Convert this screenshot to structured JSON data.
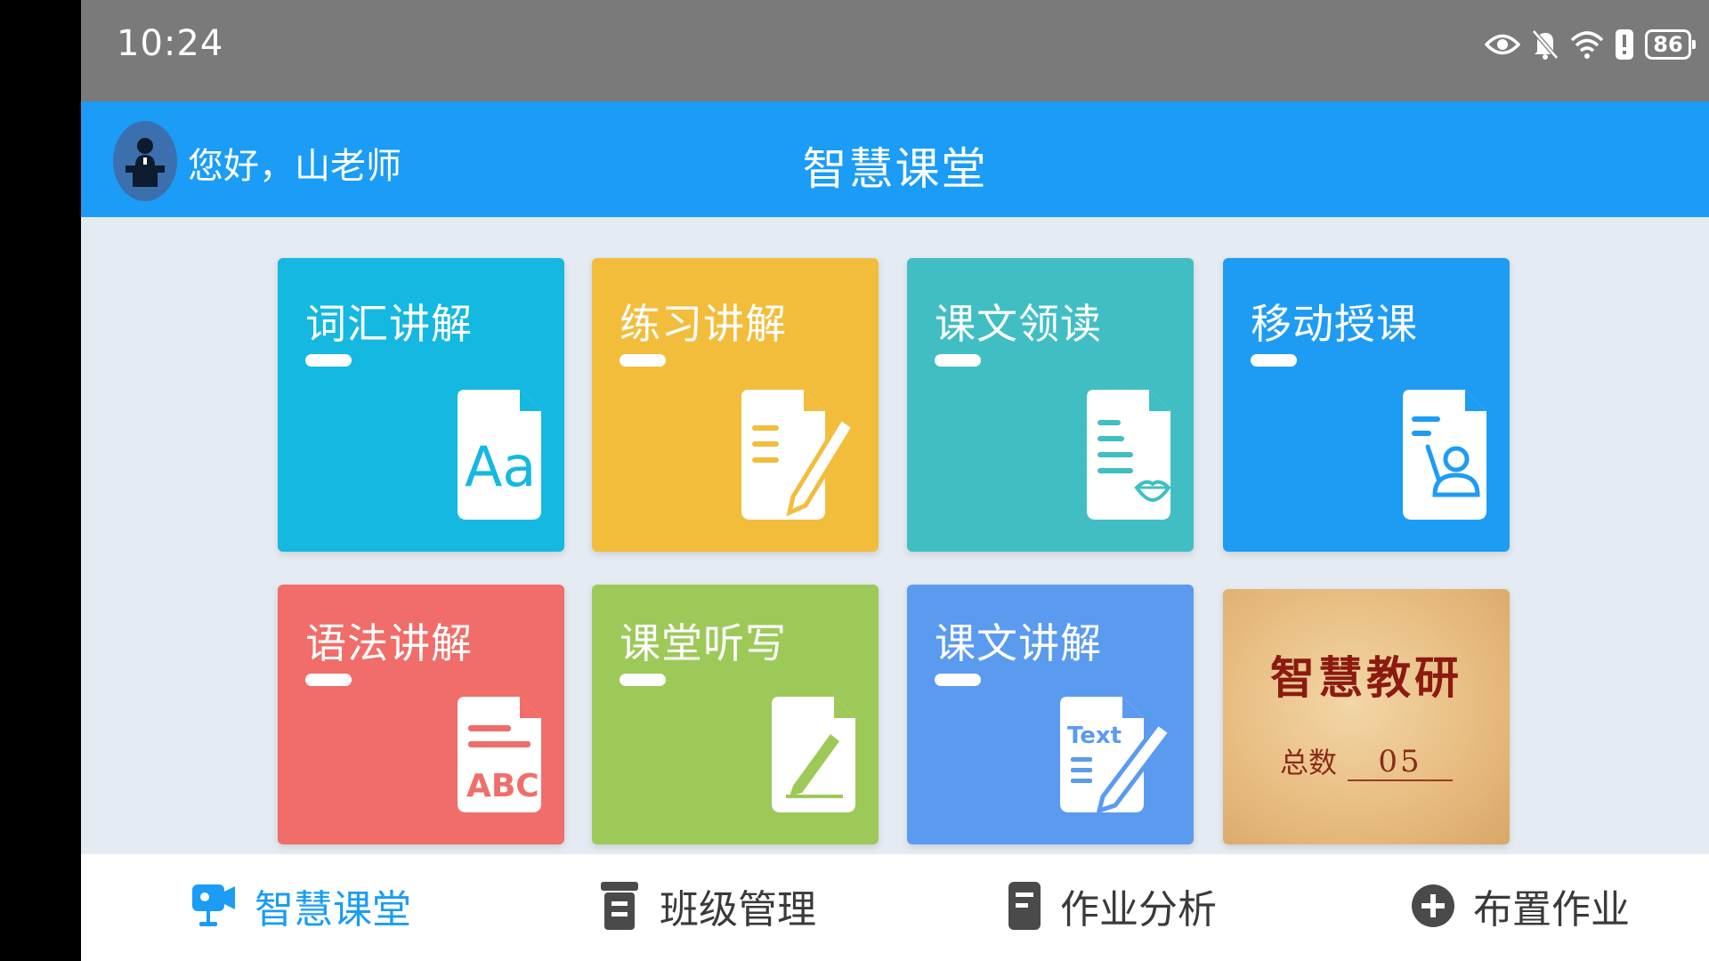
{
  "status_bar": {
    "time": "10:24",
    "battery": "86",
    "icons": [
      "eye-icon",
      "bell-off-icon",
      "wifi-icon",
      "alert-icon",
      "battery-icon"
    ]
  },
  "header": {
    "greeting": "您好，山老师",
    "title": "智慧课堂",
    "avatar_icon": "teacher-podium-icon",
    "background": "#1a9cf7"
  },
  "tiles": [
    {
      "label": "词汇讲解",
      "color": "#14b8e0",
      "icon": "vocabulary-aa-icon"
    },
    {
      "label": "练习讲解",
      "color": "#f3bd3c",
      "icon": "exercise-edit-icon"
    },
    {
      "label": "课文领读",
      "color": "#40bec4",
      "icon": "reading-lips-icon"
    },
    {
      "label": "移动授课",
      "color": "#1e9cf4",
      "icon": "mobile-teaching-icon"
    },
    {
      "label": "语法讲解",
      "color": "#f06d69",
      "icon": "grammar-abc-icon"
    },
    {
      "label": "课堂听写",
      "color": "#9dc958",
      "icon": "dictation-pen-icon"
    },
    {
      "label": "课文讲解",
      "color": "#5b9bef",
      "icon": "text-explain-icon"
    }
  ],
  "research_card": {
    "title": "智慧教研",
    "count_label": "总数",
    "count_value": "05"
  },
  "bottom_nav": [
    {
      "label": "智慧课堂",
      "icon": "classroom-video-icon",
      "active": true
    },
    {
      "label": "班级管理",
      "icon": "class-manage-icon",
      "active": false
    },
    {
      "label": "作业分析",
      "icon": "homework-analysis-icon",
      "active": false
    },
    {
      "label": "布置作业",
      "icon": "add-homework-icon",
      "active": false
    }
  ],
  "colors": {
    "accent": "#1a9cf7",
    "background": "#e5ebf2",
    "nav_text": "#3a3a3a"
  }
}
